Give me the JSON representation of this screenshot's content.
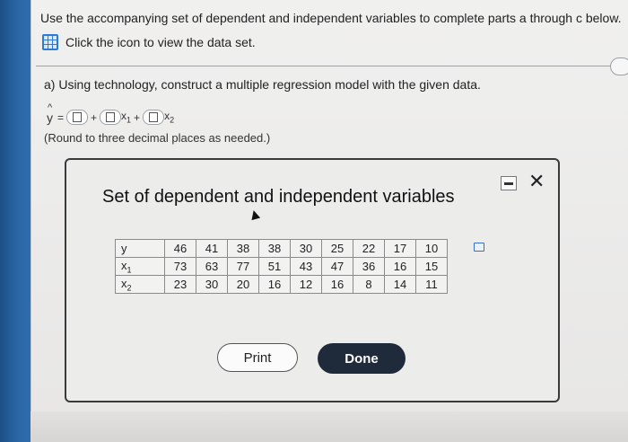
{
  "question": {
    "prompt": "Use the accompanying set of dependent and independent variables to complete parts a through c below.",
    "data_link": "Click the icon to view the data set.",
    "part_a": "a) Using technology, construct a multiple regression model with the given data.",
    "equation": {
      "lhs": "y",
      "equals": "=",
      "plus": "+",
      "x1": "x",
      "x1_sub": "1",
      "x2": "x",
      "x2_sub": "2"
    },
    "round_note": "(Round to three decimal places as needed.)"
  },
  "dialog": {
    "title": "Set of dependent and independent variables",
    "close_glyph": "✕",
    "rows": [
      {
        "label": "y",
        "sub": "",
        "values": [
          "46",
          "41",
          "38",
          "38",
          "30",
          "25",
          "22",
          "17",
          "10"
        ]
      },
      {
        "label": "x",
        "sub": "1",
        "values": [
          "73",
          "63",
          "77",
          "51",
          "43",
          "47",
          "36",
          "16",
          "15"
        ]
      },
      {
        "label": "x",
        "sub": "2",
        "values": [
          "23",
          "30",
          "20",
          "16",
          "12",
          "16",
          "8",
          "14",
          "11"
        ]
      }
    ],
    "print_label": "Print",
    "done_label": "Done"
  },
  "icons": {
    "data_set": "grid-table-icon",
    "copy": "copy-icon",
    "minimize": "minimize-icon",
    "close": "close-icon",
    "cursor": "mouse-cursor-icon"
  },
  "colors": {
    "accent_blue": "#2d7bd6",
    "done_button": "#1f2b3b"
  }
}
